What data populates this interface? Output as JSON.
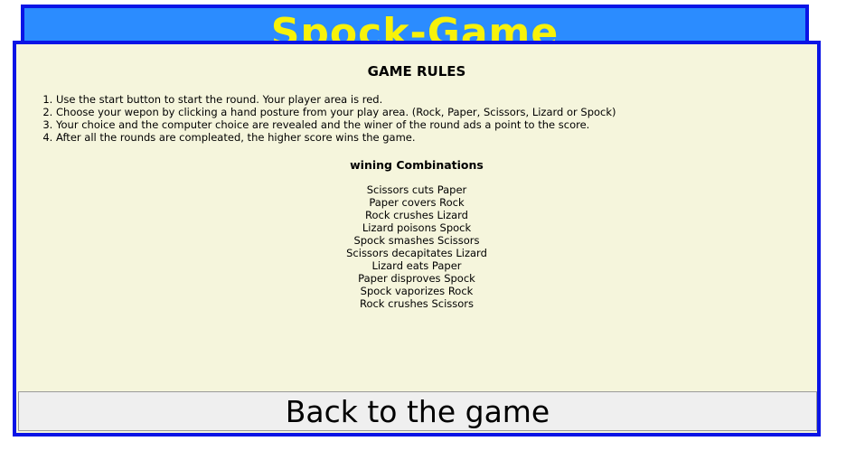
{
  "header": {
    "title": "Spock-Game"
  },
  "modal": {
    "rules_title": "GAME RULES",
    "rules": [
      "Use the start button to start the round. Your player area is red.",
      "Choose your wepon by clicking a hand posture from your play area. (Rock, Paper, Scissors, Lizard or Spock)",
      "Your choice and the computer choice are revealed and the winer of the round ads a point to the score.",
      "After all the rounds are compleated, the higher score wins the game."
    ],
    "combinations_title": "wining Combinations",
    "combinations": [
      "Scissors cuts Paper",
      "Paper covers Rock",
      "Rock crushes Lizard",
      "Lizard poisons Spock",
      "Spock smashes Scissors",
      "Scissors decapitates Lizard",
      "Lizard eats Paper",
      "Paper disproves Spock",
      "Spock vaporizes Rock",
      "Rock crushes Scissors"
    ],
    "back_button_label": "Back to the game"
  },
  "colors": {
    "header_background": "#2b8cff",
    "header_border": "#0a14e6",
    "title_color": "#f7f20a",
    "modal_background": "#f5f5dc",
    "modal_border": "#0a14e6",
    "button_background": "#efefef"
  }
}
